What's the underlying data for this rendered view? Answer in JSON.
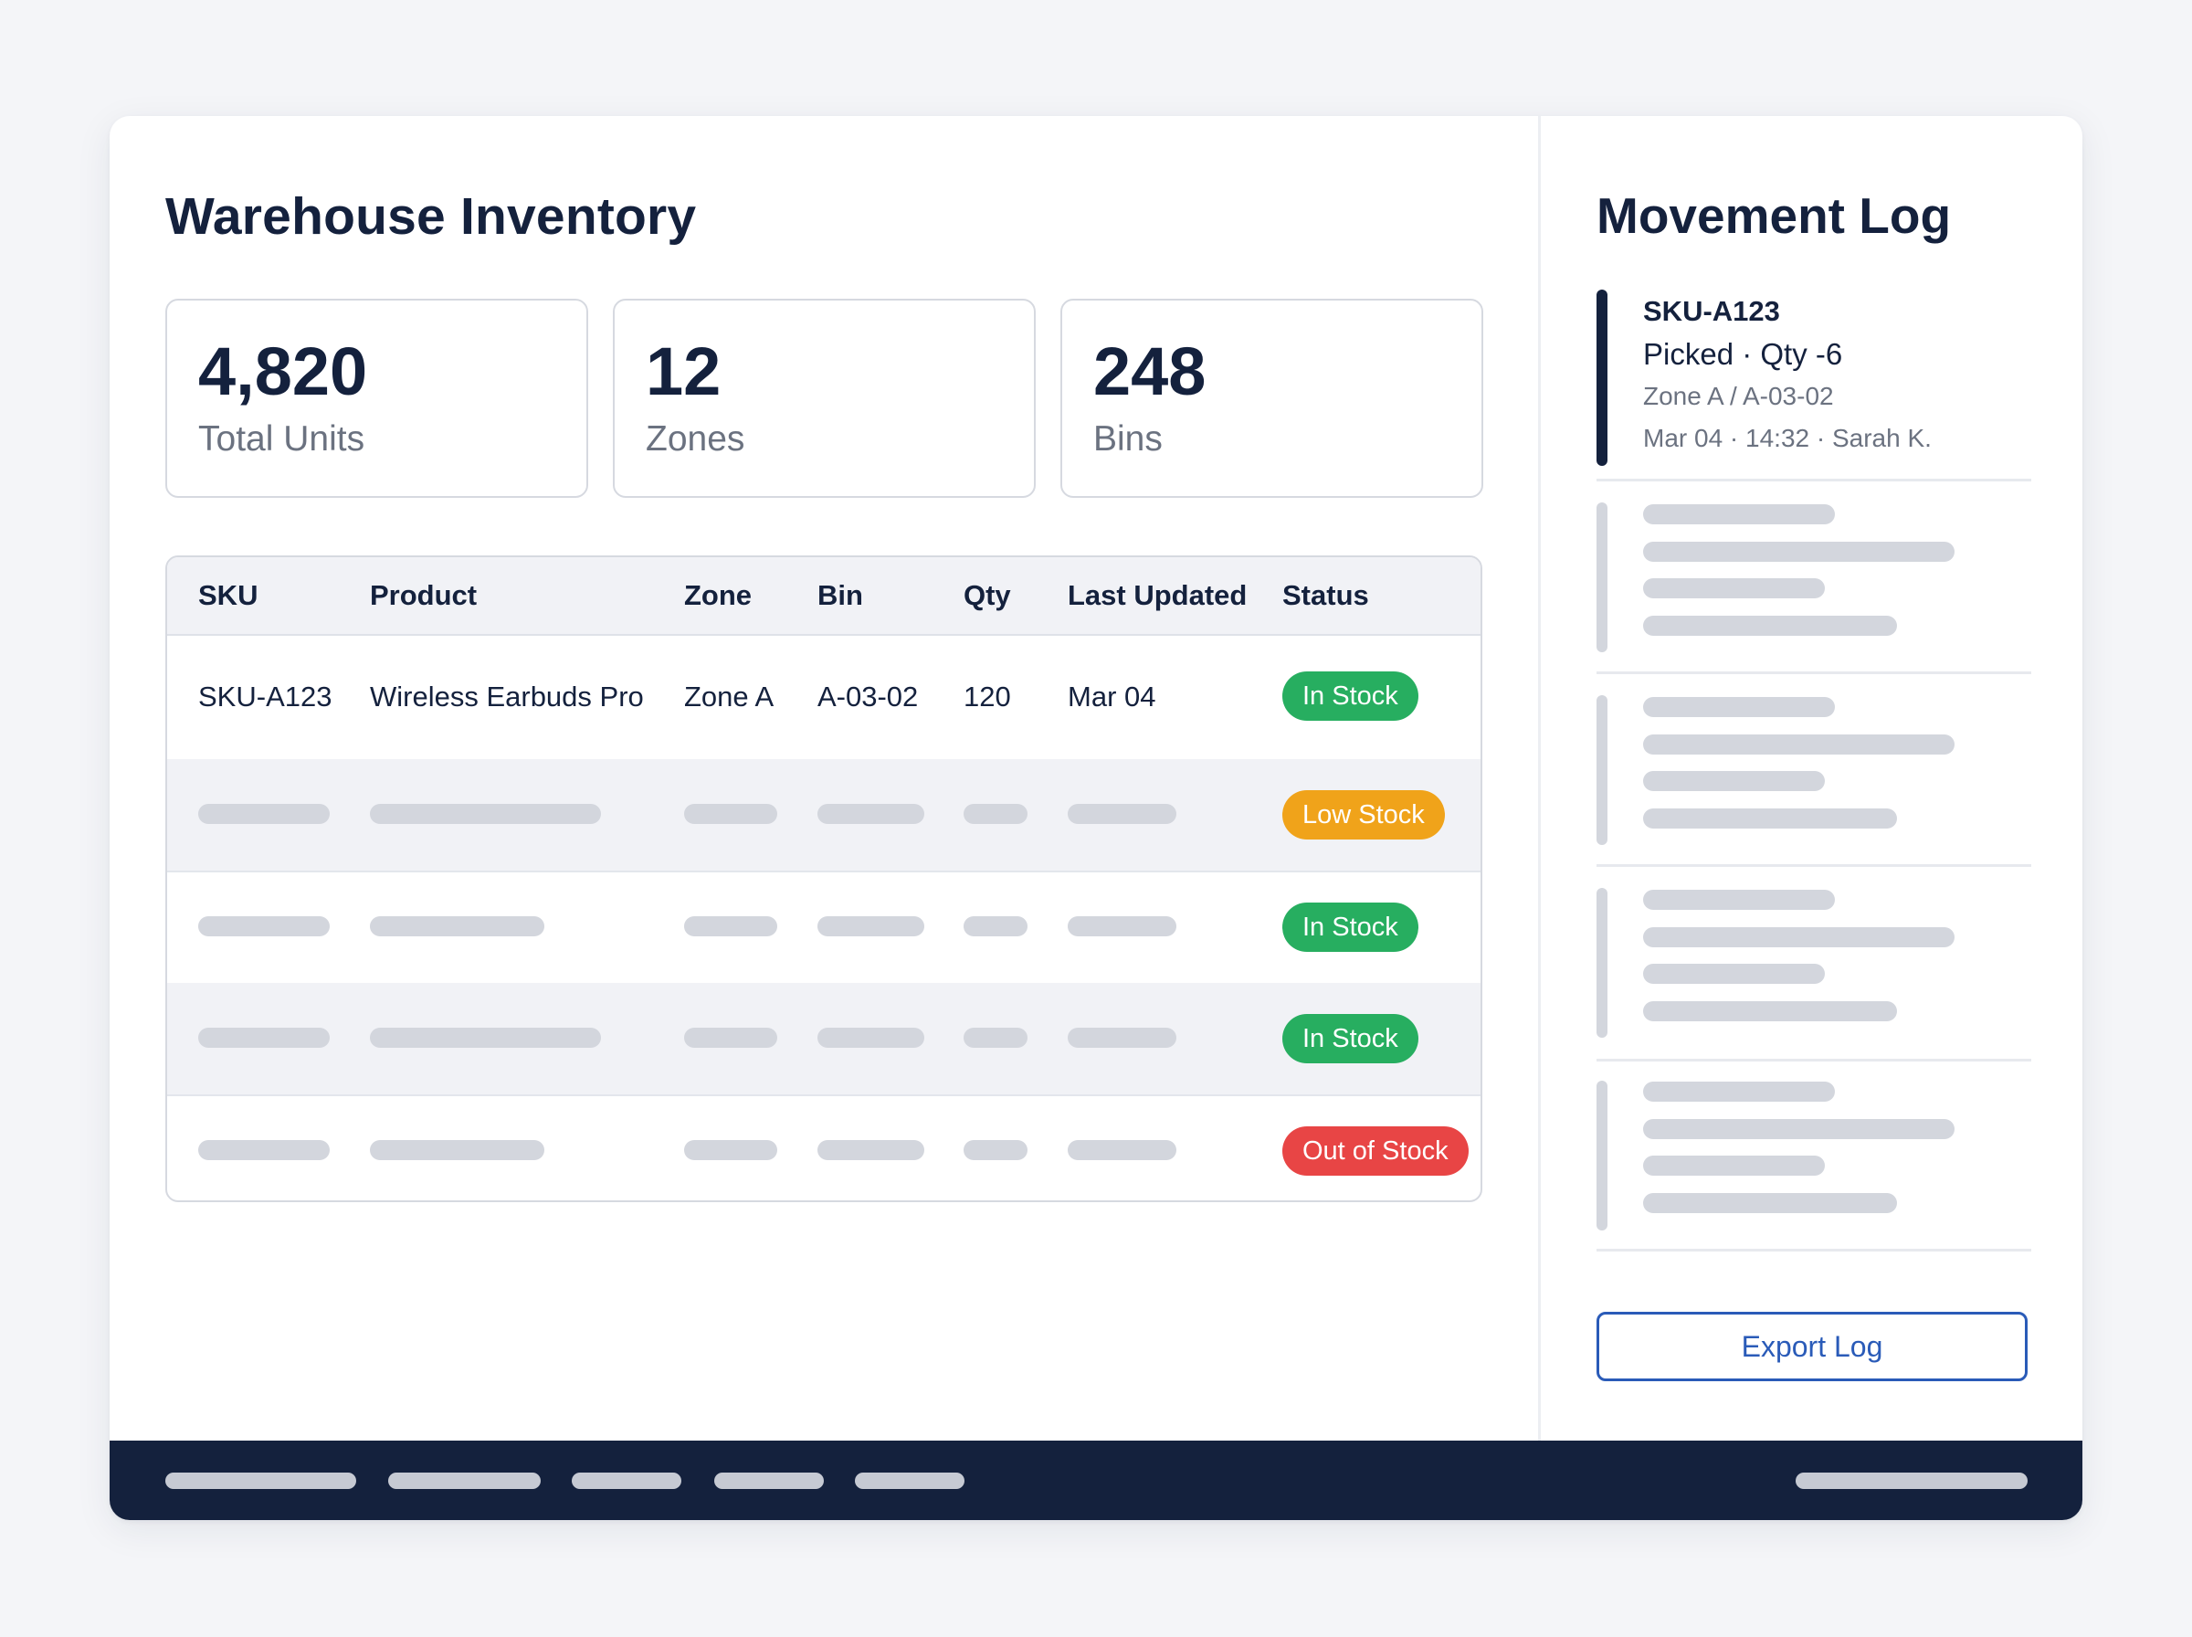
{
  "inventory": {
    "title": "Warehouse Inventory",
    "stats": [
      {
        "value": "4,820",
        "label": "Total Units"
      },
      {
        "value": "12",
        "label": "Zones"
      },
      {
        "value": "248",
        "label": "Bins"
      }
    ],
    "table": {
      "headers": {
        "sku": "SKU",
        "product": "Product",
        "zone": "Zone",
        "bin": "Bin",
        "qty": "Qty",
        "last_updated": "Last Updated",
        "status": "Status"
      },
      "row1": {
        "sku": "SKU-A123",
        "product": "Wireless Earbuds Pro",
        "zone": "Zone A",
        "bin": "A-03-02",
        "qty": "120",
        "last_updated": "Mar 04",
        "status": "In Stock"
      },
      "statuses": [
        "Low Stock",
        "In Stock",
        "In Stock",
        "Out of Stock"
      ]
    }
  },
  "log": {
    "title": "Movement Log",
    "entry": {
      "sku": "SKU-A123",
      "action": "Picked · Qty -6",
      "location": "Zone A / A-03-02",
      "meta": "Mar 04 · 14:32 · Sarah K."
    },
    "export_label": "Export Log"
  },
  "colors": {
    "navy": "#14213d",
    "in_stock": "#27ae60",
    "low_stock": "#f0a31a",
    "out_of_stock": "#e84545",
    "accent": "#2a5bb8"
  }
}
